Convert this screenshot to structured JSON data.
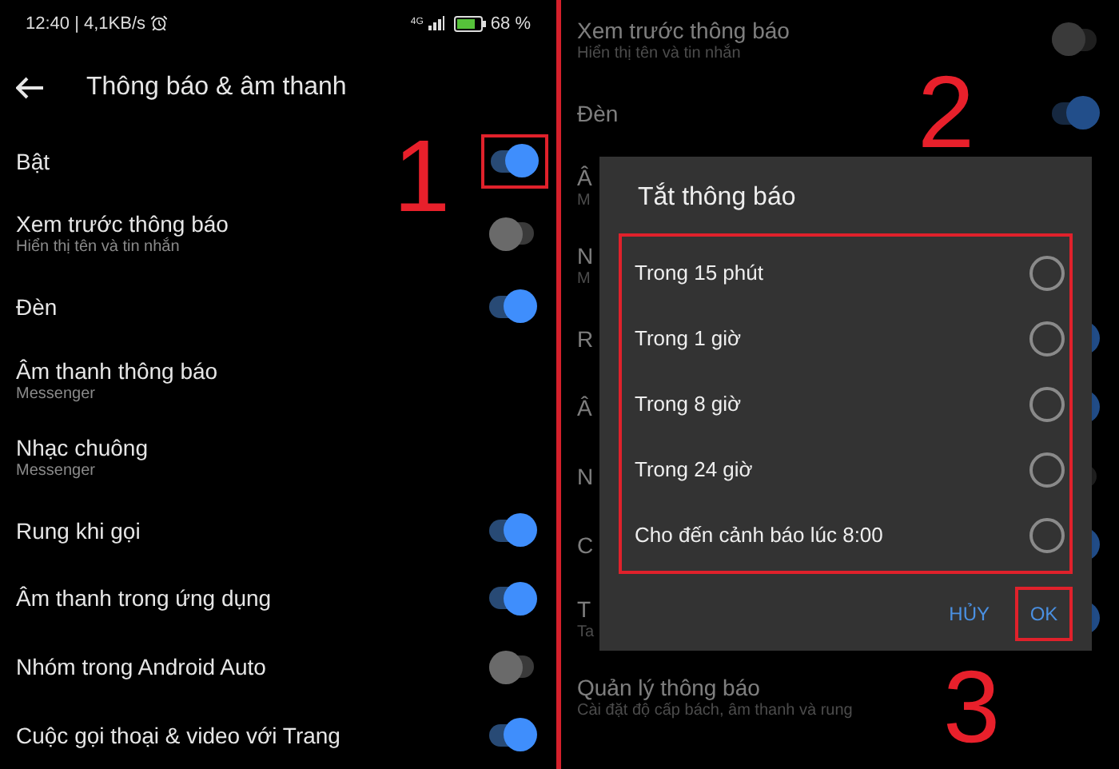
{
  "left_screen": {
    "status_bar": {
      "time": "12:40 | 4,1KB/s",
      "network": "4G",
      "battery": "68 %"
    },
    "header": {
      "title": "Thông báo & âm thanh"
    },
    "settings": [
      {
        "title": "Bật",
        "kind": "toggle",
        "on": true,
        "highlighted": true
      },
      {
        "title": "Xem trước thông báo",
        "subtitle": "Hiển thị tên và tin nhắn",
        "kind": "toggle",
        "on": false,
        "highlighted": false
      },
      {
        "title": "Đèn",
        "kind": "toggle",
        "on": true,
        "highlighted": false
      },
      {
        "title": "Âm thanh thông báo",
        "subtitle": "Messenger",
        "kind": "link"
      },
      {
        "title": "Nhạc chuông",
        "subtitle": "Messenger",
        "kind": "link"
      },
      {
        "title": "Rung khi gọi",
        "kind": "toggle",
        "on": true,
        "highlighted": false
      },
      {
        "title": "Âm thanh trong ứng dụng",
        "kind": "toggle",
        "on": true,
        "highlighted": false
      },
      {
        "title": "Nhóm trong Android Auto",
        "kind": "toggle",
        "on": false,
        "highlighted": false
      },
      {
        "title": "Cuộc gọi thoại & video với Trang",
        "kind": "toggle",
        "on": true,
        "highlighted": false
      }
    ]
  },
  "right_screen": {
    "settings": [
      {
        "title": "Xem trước thông báo",
        "subtitle": "Hiển thị tên và tin nhắn",
        "kind": "toggle",
        "on": false
      },
      {
        "title": "Đèn",
        "kind": "toggle",
        "on": true
      },
      {
        "title": "Â",
        "subtitle": "M",
        "kind": "link"
      },
      {
        "title": "N",
        "subtitle": "M",
        "kind": "link"
      },
      {
        "title": "R",
        "kind": "toggle",
        "on": true
      },
      {
        "title": "Â",
        "kind": "toggle",
        "on": true
      },
      {
        "title": "N",
        "kind": "toggle",
        "on": false
      },
      {
        "title": "C",
        "kind": "toggle",
        "on": true
      },
      {
        "title": "T",
        "subtitle": "Ta",
        "kind": "toggle",
        "on": true
      },
      {
        "title": "Quản lý thông báo",
        "subtitle": "Cài đặt độ cấp bách, âm thanh và rung",
        "kind": "link"
      }
    ],
    "dialog": {
      "title": "Tắt thông báo",
      "options": [
        {
          "label": "Trong 15 phút",
          "selected": false
        },
        {
          "label": "Trong 1 giờ",
          "selected": false
        },
        {
          "label": "Trong 8 giờ",
          "selected": false
        },
        {
          "label": "Trong 24 giờ",
          "selected": false
        },
        {
          "label": "Cho đến cảnh báo lúc 8:00",
          "selected": false
        }
      ],
      "buttons": [
        {
          "label": "HỦY",
          "highlighted": false
        },
        {
          "label": "OK",
          "highlighted": true
        }
      ]
    }
  },
  "annotations": [
    {
      "label": "1"
    },
    {
      "label": "2"
    },
    {
      "label": "3"
    }
  ]
}
